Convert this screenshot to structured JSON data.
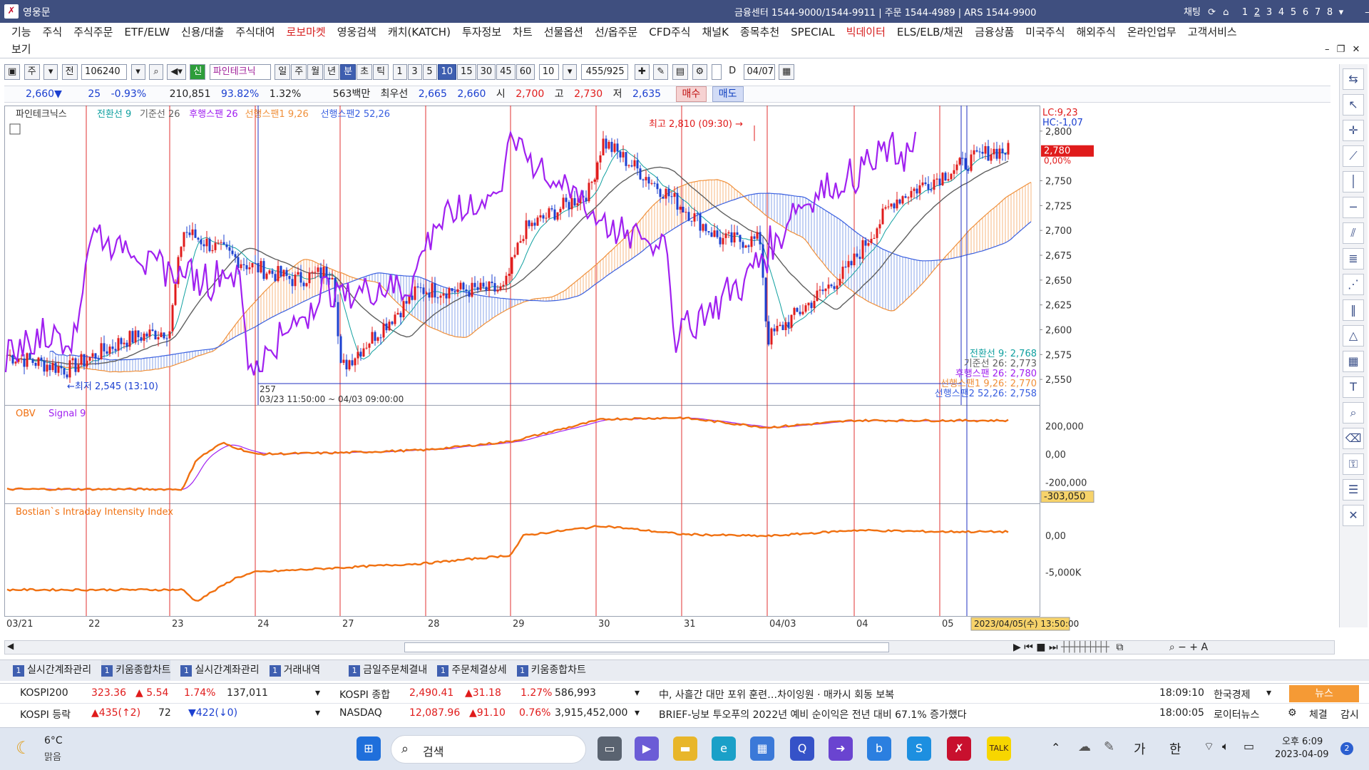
{
  "app": {
    "title": "영웅문",
    "info": "금융센터 1544-9000/1544-9911 | 주문 1544-4989 | ARS 1544-9900",
    "chat_label": "채팅",
    "pages": [
      "1",
      "2",
      "3",
      "4",
      "5",
      "6",
      "7",
      "8"
    ]
  },
  "menu": {
    "row1": [
      {
        "label": "기능",
        "color": ""
      },
      {
        "label": "주식",
        "color": ""
      },
      {
        "label": "주식주문",
        "color": ""
      },
      {
        "label": "ETF/ELW",
        "color": ""
      },
      {
        "label": "신용/대출",
        "color": ""
      },
      {
        "label": "주식대여",
        "color": ""
      },
      {
        "label": "로보마켓",
        "color": "red"
      },
      {
        "label": "영웅검색",
        "color": ""
      },
      {
        "label": "캐치(KATCH)",
        "color": ""
      },
      {
        "label": "투자정보",
        "color": ""
      },
      {
        "label": "차트",
        "color": ""
      },
      {
        "label": "선물옵션",
        "color": ""
      },
      {
        "label": "선/옵주문",
        "color": ""
      },
      {
        "label": "CFD주식",
        "color": ""
      },
      {
        "label": "채널K",
        "color": ""
      },
      {
        "label": "종목추천",
        "color": ""
      },
      {
        "label": "SPECIAL",
        "color": ""
      },
      {
        "label": "빅데이터",
        "color": "red"
      },
      {
        "label": "ELS/ELB/채권",
        "color": ""
      },
      {
        "label": "금융상품",
        "color": ""
      },
      {
        "label": "미국주식",
        "color": ""
      },
      {
        "label": "해외주식",
        "color": ""
      },
      {
        "label": "온라인업무",
        "color": ""
      },
      {
        "label": "고객서비스",
        "color": ""
      }
    ],
    "row2": [
      {
        "label": "보기"
      }
    ]
  },
  "toolbar": {
    "mode1": "주",
    "mode2": "전",
    "code": "106240",
    "credit_badge": "신",
    "stock_name": "파인테크닉",
    "periods": [
      "일",
      "주",
      "월",
      "년",
      "분",
      "초",
      "틱"
    ],
    "active_period": "분",
    "intervals": [
      "1",
      "3",
      "5",
      "10",
      "15",
      "30",
      "45",
      "60"
    ],
    "active_interval": "10",
    "interval_select": "10",
    "count": "455",
    "total": "/925",
    "d_label": "D",
    "date": "04/07"
  },
  "quote": {
    "price": "2,660",
    "dir_symbol": "▼",
    "change": "25",
    "change_pct": "-0.93%",
    "volume": "210,851",
    "vol_ratio": "93.82%",
    "turnover": "1.32%",
    "amount": "563백만",
    "best_label": "최우선",
    "ask": "2,665",
    "bid": "2,660",
    "open_label": "시",
    "open": "2,700",
    "high_label": "고",
    "high": "2,730",
    "low_label": "저",
    "low": "2,635",
    "buy_label": "매수",
    "sell_label": "매도"
  },
  "chart_data": [
    {
      "type": "candlestick",
      "title": "파인테크닉스",
      "legend": [
        {
          "name": "전환선 9",
          "color": "#10a0a0"
        },
        {
          "name": "기준선 26",
          "color": "#606060"
        },
        {
          "name": "후행스팬 26",
          "color": "#a020f0"
        },
        {
          "name": "선행스팬1 9,26",
          "color": "#f0903a"
        },
        {
          "name": "선행스팬2 52,26",
          "color": "#3a60e0"
        }
      ],
      "ylim": [
        2530,
        2820
      ],
      "y_ticks": [
        "2,800",
        "2,750",
        "2,725",
        "2,700",
        "2,675",
        "2,650",
        "2,625",
        "2,600",
        "2,575",
        "2,550"
      ],
      "lc": "LC:9,23",
      "hc": "HC:-1,07",
      "current_price_tag": "2,780",
      "current_pct_tag": "0,00%",
      "annotations": {
        "high": "최고 2,810 (09:30)",
        "low": "최저 2,545 (13:10)",
        "range_count": "257",
        "range_period": "03/23 11:50:00 ~ 04/03 09:00:00"
      },
      "values_legend": [
        {
          "text": "전환선 9: 2,768",
          "color": "#10a0a0"
        },
        {
          "text": "기준선 26: 2,773",
          "color": "#606060"
        },
        {
          "text": "후행스팬 26: 2,780",
          "color": "#a020f0"
        },
        {
          "text": "선행스팬1 9,26: 2,770",
          "color": "#f0903a"
        },
        {
          "text": "선행스팬2 52,26: 2,758",
          "color": "#3a60e0"
        }
      ],
      "close_keypoints": [
        {
          "x": "03/21 09:00",
          "y": 2575
        },
        {
          "x": "03/21 14:00",
          "y": 2560
        },
        {
          "x": "03/22 12:00",
          "y": 2590
        },
        {
          "x": "03/23 09:00",
          "y": 2600
        },
        {
          "x": "03/23 10:00",
          "y": 2700
        },
        {
          "x": "03/23 15:00",
          "y": 2665
        },
        {
          "x": "03/24 12:00",
          "y": 2650
        },
        {
          "x": "03/24 15:00",
          "y": 2660
        },
        {
          "x": "03/27 09:00",
          "y": 2560
        },
        {
          "x": "03/27 15:00",
          "y": 2640
        },
        {
          "x": "03/28 15:00",
          "y": 2640
        },
        {
          "x": "03/29 10:00",
          "y": 2700
        },
        {
          "x": "03/29 15:00",
          "y": 2740
        },
        {
          "x": "03/30 09:30",
          "y": 2790
        },
        {
          "x": "03/30 15:00",
          "y": 2730
        },
        {
          "x": "03/31 12:00",
          "y": 2690
        },
        {
          "x": "03/31 15:00",
          "y": 2690
        },
        {
          "x": "04/03 09:00",
          "y": 2590
        },
        {
          "x": "04/03 15:00",
          "y": 2660
        },
        {
          "x": "04/04 12:00",
          "y": 2730
        },
        {
          "x": "04/05 10:00",
          "y": 2760
        },
        {
          "x": "04/05 13:50",
          "y": 2780
        }
      ]
    },
    {
      "type": "line",
      "title": "OBV",
      "series": [
        {
          "name": "OBV",
          "color": "#f07010"
        },
        {
          "name": "Signal 9",
          "color": "#a020f0"
        }
      ],
      "y_ticks": [
        "200,000",
        "0,00",
        "-200,000"
      ],
      "current_tag": "-303,050",
      "keypoints": [
        {
          "x": "03/21",
          "y": -250000
        },
        {
          "x": "03/23 10:00",
          "y": -250000
        },
        {
          "x": "03/23 11:00",
          "y": -40000
        },
        {
          "x": "03/23 13:00",
          "y": 80000
        },
        {
          "x": "03/24 09:00",
          "y": 0
        },
        {
          "x": "03/27",
          "y": 10000
        },
        {
          "x": "03/28",
          "y": 30000
        },
        {
          "x": "03/29",
          "y": 90000
        },
        {
          "x": "03/30 09:30",
          "y": 250000
        },
        {
          "x": "03/31",
          "y": 260000
        },
        {
          "x": "04/03",
          "y": 190000
        },
        {
          "x": "04/04",
          "y": 240000
        },
        {
          "x": "04/05",
          "y": 240000
        }
      ]
    },
    {
      "type": "line",
      "title": "Bostian`s Intraday Intensity Index",
      "series": [
        {
          "name": "Bostian`s Intraday Intensity Index",
          "color": "#f07010"
        }
      ],
      "y_ticks": [
        "0,00",
        "-5,000K"
      ],
      "keypoints": [
        {
          "x": "03/21",
          "y": -7400
        },
        {
          "x": "03/23 10:00",
          "y": -7400
        },
        {
          "x": "03/23 11:00",
          "y": -9000
        },
        {
          "x": "03/23 14:00",
          "y": -5800
        },
        {
          "x": "03/24",
          "y": -5000
        },
        {
          "x": "03/27",
          "y": -4400
        },
        {
          "x": "03/28",
          "y": -3800
        },
        {
          "x": "03/29 09:00",
          "y": -2700
        },
        {
          "x": "03/29 10:00",
          "y": 0
        },
        {
          "x": "03/30 09:30",
          "y": 1300
        },
        {
          "x": "03/31",
          "y": 150
        },
        {
          "x": "04/03",
          "y": -100
        },
        {
          "x": "04/04",
          "y": 700
        },
        {
          "x": "04/05",
          "y": 500
        }
      ]
    }
  ],
  "x_axis": {
    "labels": [
      "03/21",
      "22",
      "23",
      "24",
      "27",
      "28",
      "29",
      "30",
      "31",
      "04/03",
      "04",
      "05"
    ],
    "cursor_label": "2023/04/05(수) 13:50:00"
  },
  "tabs": [
    {
      "n": "1",
      "label": "실시간계좌관리"
    },
    {
      "n": "1",
      "label": "키움종합차트"
    },
    {
      "n": "1",
      "label": "실시간계좌관리"
    },
    {
      "n": "1",
      "label": "거래내역"
    },
    {
      "n": "1",
      "label": "금일주문체결내"
    },
    {
      "n": "1",
      "label": "주문체결상세"
    },
    {
      "n": "1",
      "label": "키움종합차트"
    }
  ],
  "tickers": {
    "kospi200": {
      "name": "KOSPI200",
      "value": "323.36",
      "change": "▲ 5.54",
      "pct": "1.74%",
      "volume": "137,011"
    },
    "kospi_breadth": {
      "name": "KOSPI 등락",
      "up": "▲435(↑2)",
      "flat": "72",
      "down": "▼422(↓0)"
    },
    "kospi": {
      "name": "KOSPI 종합",
      "value": "2,490.41",
      "change": "▲31.18",
      "pct": "1.27%",
      "volume": "586,993"
    },
    "nasdaq": {
      "name": "NASDAQ",
      "value": "12,087.96",
      "change": "▲91.10",
      "pct": "0.76%",
      "volume": "3,915,452,000"
    },
    "news1": {
      "text": "中, 사흘간 대만 포위 훈련…차이잉원 · 매카시 회동 보복",
      "time": "18:09:10",
      "source": "한국경제"
    },
    "news2": {
      "text": "BRIEF-닝보 투오푸의 2022년 예비 순이익은 전년 대비 67.1% 증가했다",
      "time": "18:00:05",
      "source": "로이터뉴스"
    },
    "news_button": "뉴스",
    "exec_button": "체결",
    "monitor_button": "감시"
  },
  "taskbar": {
    "weather_temp": "6°C",
    "weather_desc": "맑음",
    "search_placeholder": "검색",
    "ime1": "가",
    "ime2": "한",
    "time": "오후 6:09",
    "date": "2023-04-09",
    "notif_count": "2"
  }
}
